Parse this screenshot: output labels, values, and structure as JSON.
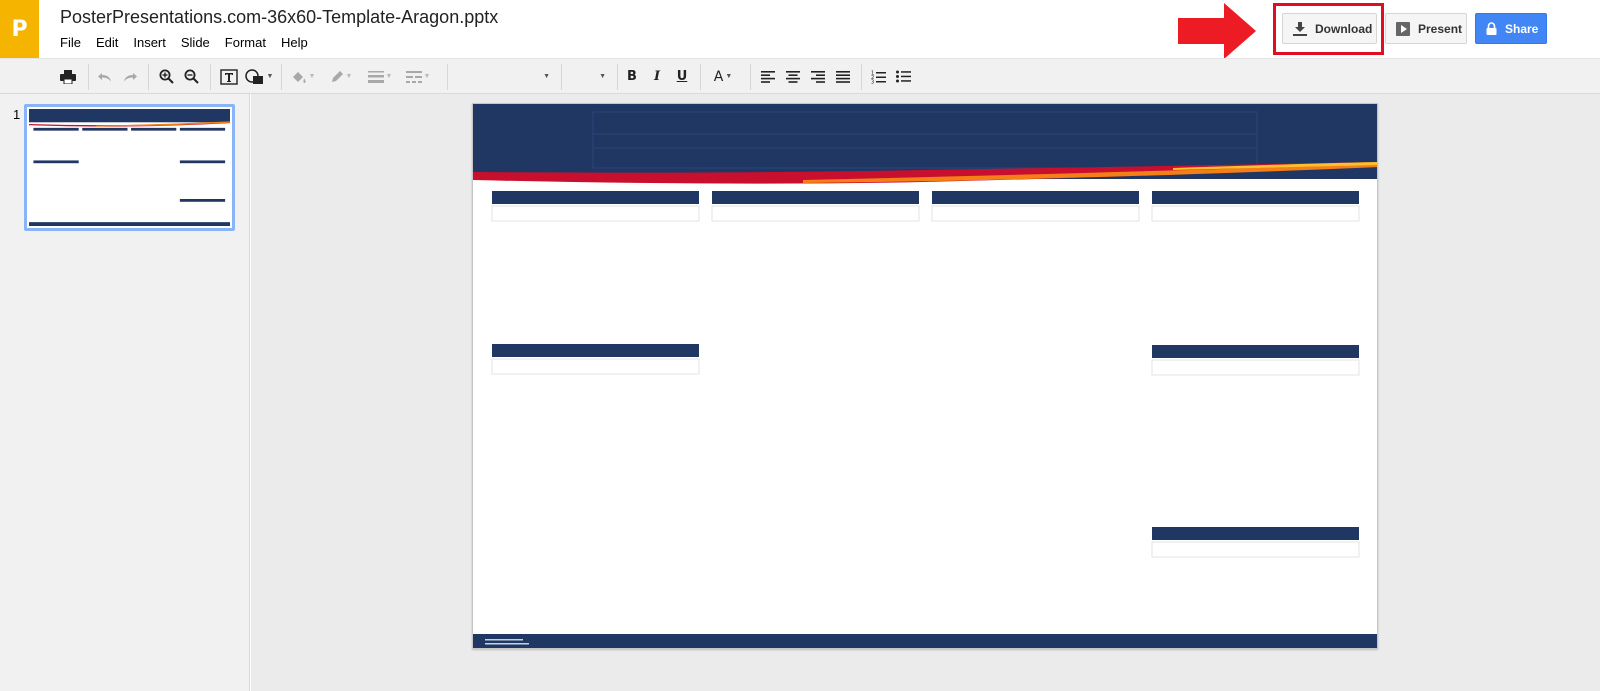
{
  "app": {
    "logo_letter": "P"
  },
  "document": {
    "title": "PosterPresentations.com-36x60-Template-Aragon.pptx"
  },
  "menu": [
    "File",
    "Edit",
    "Insert",
    "Slide",
    "Format",
    "Help"
  ],
  "actions": {
    "download_label": "Download",
    "present_label": "Present",
    "share_label": "Share"
  },
  "annotation": {
    "highlight_color": "#e00d23",
    "arrow_color": "#ed1c24"
  },
  "toolbar": {
    "bold": "B",
    "italic": "I",
    "underline": "U",
    "text_color": "A"
  },
  "filmstrip": {
    "slides": [
      {
        "number": "1"
      }
    ]
  },
  "theme": {
    "navy": "#213763",
    "red_band": "#c8102e",
    "orange_band": "#f57f17",
    "yellow_band": "#fbc02d",
    "share_blue": "#4285f4",
    "logo_yellow": "#f4b400"
  }
}
